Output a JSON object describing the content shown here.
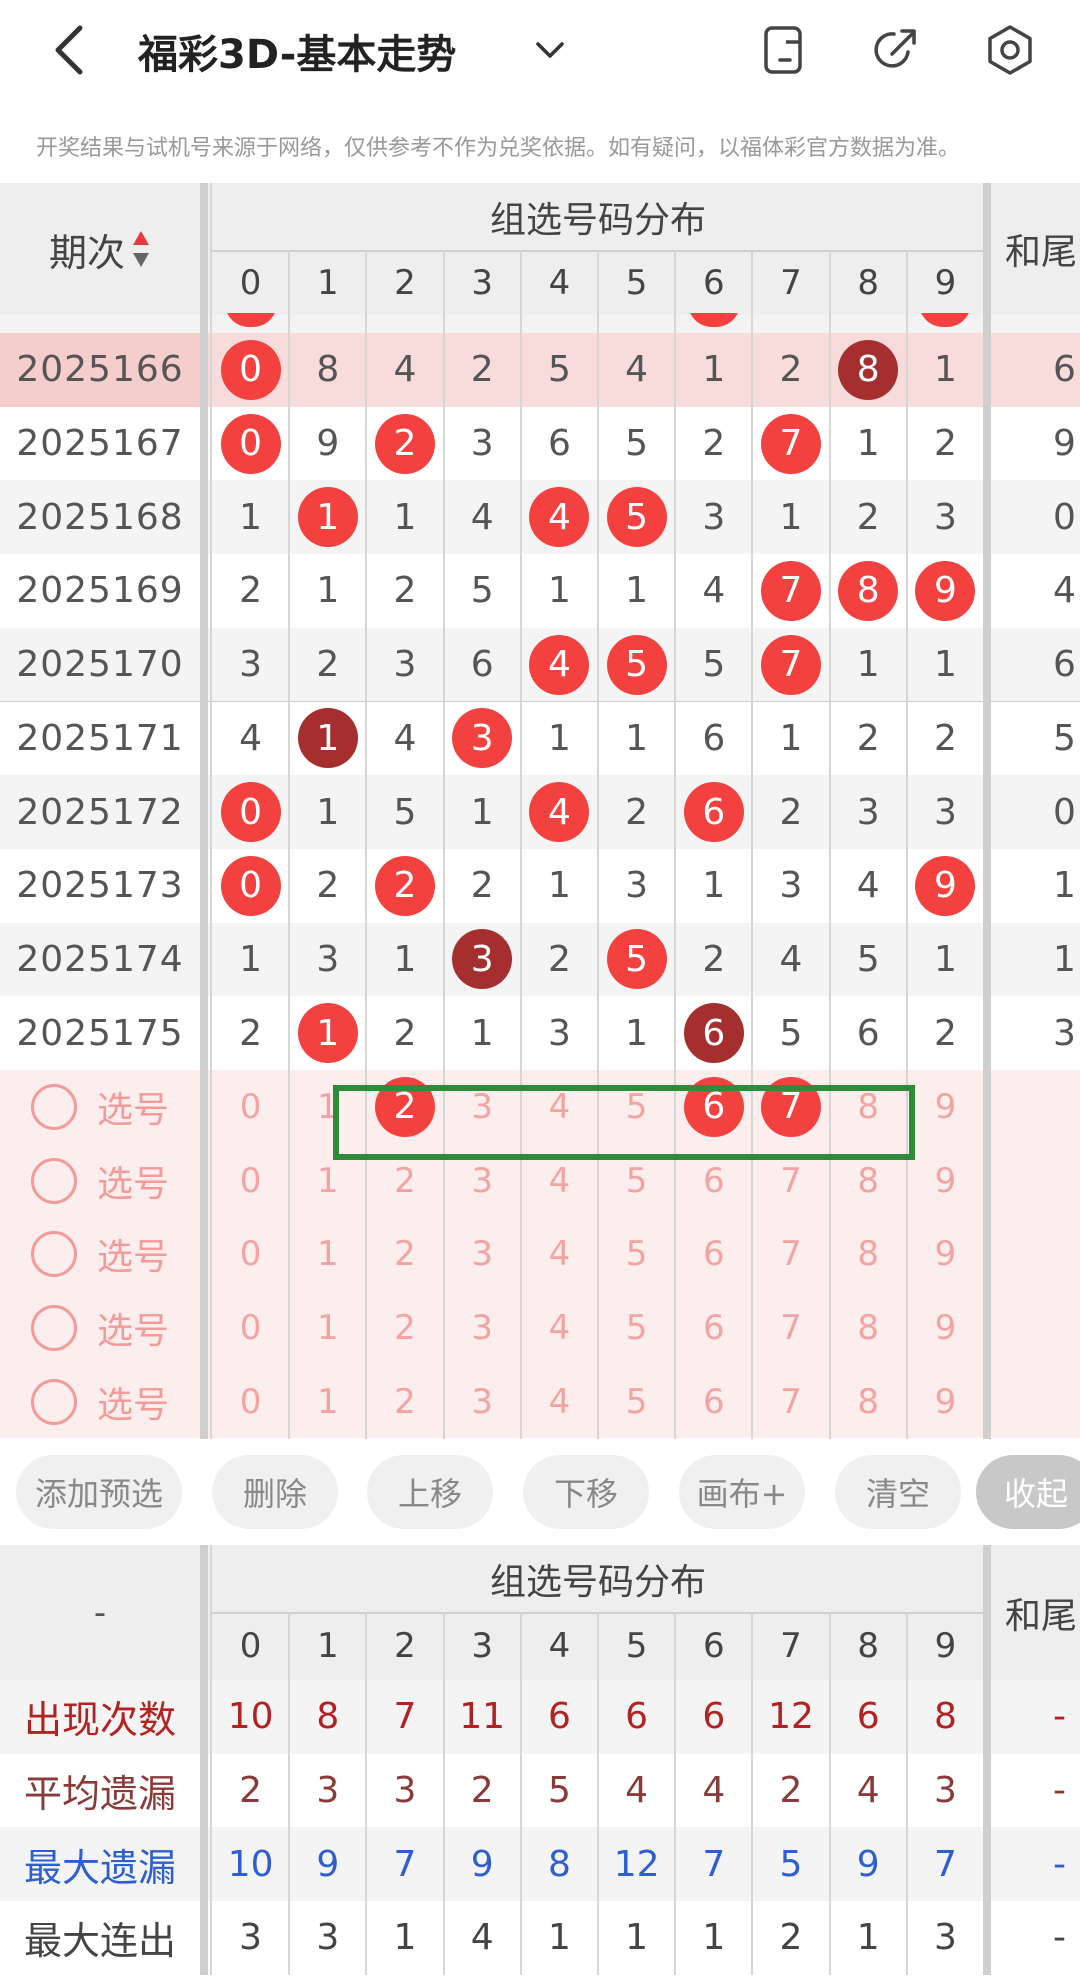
{
  "header": {
    "title": "福彩3D-基本走势",
    "notice": "开奖结果与试机号来源于网络，仅供参考不作为兑奖依据。如有疑问，以福体彩官方数据为准。"
  },
  "table": {
    "period_header": "期次",
    "group_header": "组选号码分布",
    "sum_header": "和尾",
    "digits": [
      "0",
      "1",
      "2",
      "3",
      "4",
      "5",
      "6",
      "7",
      "8",
      "9"
    ],
    "rows": [
      {
        "period": "2025166",
        "cells": [
          "0",
          "8",
          "4",
          "2",
          "5",
          "4",
          "1",
          "2",
          "8",
          "1"
        ],
        "balls": {
          "0": "red",
          "8": "dark"
        },
        "sum": "6",
        "highlight": true
      },
      {
        "period": "2025167",
        "cells": [
          "0",
          "9",
          "2",
          "3",
          "6",
          "5",
          "2",
          "7",
          "1",
          "2"
        ],
        "balls": {
          "0": "red",
          "2": "red",
          "7": "red"
        },
        "sum": "9"
      },
      {
        "period": "2025168",
        "cells": [
          "1",
          "1",
          "1",
          "4",
          "4",
          "5",
          "3",
          "1",
          "2",
          "3"
        ],
        "balls": {
          "1": "red",
          "4": "red",
          "5": "red"
        },
        "sum": "0"
      },
      {
        "period": "2025169",
        "cells": [
          "2",
          "1",
          "2",
          "5",
          "1",
          "1",
          "4",
          "7",
          "8",
          "9"
        ],
        "balls": {
          "7": "red",
          "8": "red",
          "9": "red"
        },
        "sum": "4"
      },
      {
        "period": "2025170",
        "cells": [
          "3",
          "2",
          "3",
          "6",
          "4",
          "5",
          "5",
          "7",
          "1",
          "1"
        ],
        "balls": {
          "4": "red",
          "5": "red",
          "7": "red"
        },
        "sum": "6"
      },
      {
        "period": "2025171",
        "cells": [
          "4",
          "1",
          "4",
          "3",
          "1",
          "1",
          "6",
          "1",
          "2",
          "2"
        ],
        "balls": {
          "1": "dark",
          "3": "red"
        },
        "sum": "5"
      },
      {
        "period": "2025172",
        "cells": [
          "0",
          "1",
          "5",
          "1",
          "4",
          "2",
          "6",
          "2",
          "3",
          "3"
        ],
        "balls": {
          "0": "red",
          "4": "red",
          "6": "red"
        },
        "sum": "0"
      },
      {
        "period": "2025173",
        "cells": [
          "0",
          "2",
          "2",
          "2",
          "1",
          "3",
          "1",
          "3",
          "4",
          "9"
        ],
        "balls": {
          "0": "red",
          "2": "red",
          "9": "red"
        },
        "sum": "1"
      },
      {
        "period": "2025174",
        "cells": [
          "1",
          "3",
          "1",
          "3",
          "2",
          "5",
          "2",
          "4",
          "5",
          "1"
        ],
        "balls": {
          "3": "dark",
          "5": "red"
        },
        "sum": "1"
      },
      {
        "period": "2025175",
        "cells": [
          "2",
          "1",
          "2",
          "1",
          "3",
          "1",
          "6",
          "5",
          "6",
          "2"
        ],
        "balls": {
          "1": "red",
          "6": "dark"
        },
        "sum": "3"
      }
    ],
    "select_label": "选号",
    "select_rows": [
      {
        "selected": [
          "2",
          "6",
          "7"
        ]
      },
      {
        "selected": []
      },
      {
        "selected": []
      },
      {
        "selected": []
      },
      {
        "selected": []
      }
    ]
  },
  "toolbar": {
    "add": "添加预选",
    "delete": "删除",
    "up": "上移",
    "down": "下移",
    "canvas": "画布+",
    "clear": "清空",
    "collapse": "收起"
  },
  "stats": {
    "corner": "-",
    "group_header": "组选号码分布",
    "sum_header": "和尾",
    "rows": [
      {
        "label": "出现次数",
        "values": [
          "10",
          "8",
          "7",
          "11",
          "6",
          "6",
          "6",
          "12",
          "6",
          "8"
        ],
        "sum": "-",
        "color": "#b22222"
      },
      {
        "label": "平均遗漏",
        "values": [
          "2",
          "3",
          "3",
          "2",
          "5",
          "4",
          "4",
          "2",
          "4",
          "3"
        ],
        "sum": "-",
        "color": "#8b3a3a"
      },
      {
        "label": "最大遗漏",
        "values": [
          "10",
          "9",
          "7",
          "9",
          "8",
          "12",
          "7",
          "5",
          "9",
          "7"
        ],
        "sum": "-",
        "color": "#2f5fcf"
      },
      {
        "label": "最大连出",
        "values": [
          "3",
          "3",
          "1",
          "4",
          "1",
          "1",
          "1",
          "2",
          "1",
          "3"
        ],
        "sum": "-",
        "color": "#444444"
      }
    ]
  },
  "colors": {
    "ball_red": "#f2413f",
    "ball_dark": "#a52f2f",
    "highlight_box": "#2e8b3a"
  }
}
